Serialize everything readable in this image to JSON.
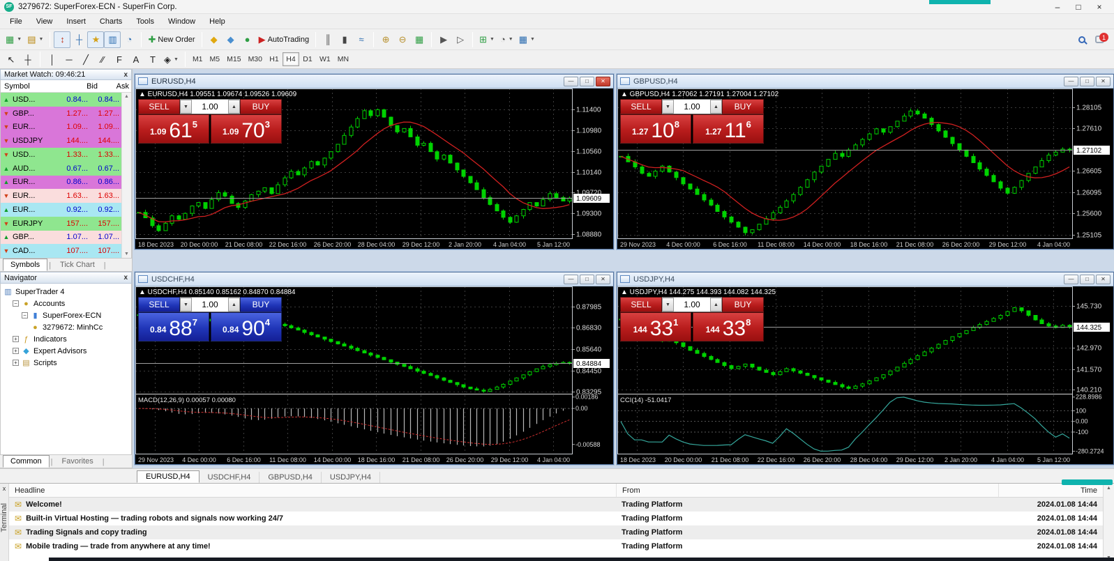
{
  "app": {
    "title": "3279672: SuperForex-ECN - SuperFin Corp.",
    "logo": "SF",
    "menus": [
      "File",
      "View",
      "Insert",
      "Charts",
      "Tools",
      "Window",
      "Help"
    ],
    "notification_count": "1"
  },
  "toolbar": {
    "standard": [
      {
        "name": "new-chart",
        "glyph": "▦",
        "color": "#2f9e44",
        "dd": true
      },
      {
        "name": "profiles",
        "glyph": "▤",
        "color": "#b8860b",
        "dd": true
      },
      {
        "name": "sep"
      },
      {
        "name": "market-watch",
        "glyph": "↕",
        "color": "#c23b22",
        "pressed": true
      },
      {
        "name": "data-window",
        "glyph": "┼",
        "color": "#2b6cb0"
      },
      {
        "name": "navigator",
        "glyph": "★",
        "color": "#d4a017",
        "pressed": true
      },
      {
        "name": "terminal",
        "glyph": "▥",
        "color": "#2b6cb0",
        "pressed": true
      },
      {
        "name": "strategy-tester",
        "glyph": "◔",
        "color": "#2b6cb0"
      },
      {
        "name": "sep"
      },
      {
        "name": "new-order",
        "glyph": "✚",
        "color": "#2f9e44",
        "label": "New Order"
      },
      {
        "name": "sep"
      },
      {
        "name": "metaeditor",
        "glyph": "◆",
        "color": "#e0a810"
      },
      {
        "name": "experts",
        "glyph": "◆",
        "color": "#4a8fd0"
      },
      {
        "name": "signals",
        "glyph": "●",
        "color": "#2f9e44"
      },
      {
        "name": "autotrading",
        "glyph": "▶",
        "color": "#cc2222",
        "label": "AutoTrading"
      },
      {
        "name": "sep"
      },
      {
        "name": "bar-chart-mode",
        "glyph": "║",
        "color": "#444444"
      },
      {
        "name": "candlestick-mode",
        "glyph": "▮",
        "color": "#444444"
      },
      {
        "name": "line-chart-mode",
        "glyph": "≈",
        "color": "#2b6cb0"
      },
      {
        "name": "sep"
      },
      {
        "name": "zoom-in",
        "glyph": "⊕",
        "color": "#b8912f"
      },
      {
        "name": "zoom-out",
        "glyph": "⊖",
        "color": "#b8912f"
      },
      {
        "name": "tile-windows",
        "glyph": "▦",
        "color": "#2f9e44"
      },
      {
        "name": "sep"
      },
      {
        "name": "auto-scroll",
        "glyph": "▶",
        "color": "#555555"
      },
      {
        "name": "chart-shift",
        "glyph": "▷",
        "color": "#555555"
      },
      {
        "name": "sep"
      },
      {
        "name": "indicators-list",
        "glyph": "⊞",
        "color": "#2f9e44",
        "dd": true
      },
      {
        "name": "periods",
        "glyph": "◔",
        "color": "#555555",
        "dd": true
      },
      {
        "name": "templates",
        "glyph": "▦",
        "color": "#2b6cb0",
        "dd": true
      }
    ],
    "drawing": [
      {
        "name": "cursor",
        "glyph": "↖",
        "color": "#222222"
      },
      {
        "name": "crosshair",
        "glyph": "┼",
        "color": "#222222"
      },
      {
        "name": "sep"
      },
      {
        "name": "vertical-line",
        "glyph": "│",
        "color": "#222222"
      },
      {
        "name": "horizontal-line",
        "glyph": "─",
        "color": "#222222"
      },
      {
        "name": "trendline",
        "glyph": "╱",
        "color": "#222222"
      },
      {
        "name": "equidistant-channel",
        "glyph": "∕∕",
        "color": "#222222"
      },
      {
        "name": "fibonacci",
        "glyph": "F",
        "color": "#222222"
      },
      {
        "name": "text",
        "glyph": "A",
        "color": "#222222"
      },
      {
        "name": "text-label",
        "glyph": "T",
        "color": "#222222"
      },
      {
        "name": "arrows-tool",
        "glyph": "◈",
        "color": "#222222",
        "dd": true
      }
    ],
    "timeframes": [
      "M1",
      "M5",
      "M15",
      "M30",
      "H1",
      "H4",
      "D1",
      "W1",
      "MN"
    ],
    "active_timeframe": "H4"
  },
  "market_watch": {
    "title": "Market Watch: 09:46:21",
    "columns": [
      "Symbol",
      "Bid",
      "Ask"
    ],
    "rows": [
      {
        "symbol": "USD...",
        "bid": "0.84...",
        "ask": "0.84...",
        "arrow": "up",
        "bg": "green",
        "txt": "blue"
      },
      {
        "symbol": "GBP...",
        "bid": "1.27...",
        "ask": "1.27...",
        "arrow": "down",
        "bg": "magenta",
        "txt": "red"
      },
      {
        "symbol": "EUR...",
        "bid": "1.09...",
        "ask": "1.09...",
        "arrow": "down",
        "bg": "magenta",
        "txt": "red"
      },
      {
        "symbol": "USDJPY",
        "bid": "144....",
        "ask": "144....",
        "arrow": "down",
        "bg": "magenta",
        "txt": "red"
      },
      {
        "symbol": "USD...",
        "bid": "1.33...",
        "ask": "1.33...",
        "arrow": "down",
        "bg": "green",
        "txt": "red"
      },
      {
        "symbol": "AUD...",
        "bid": "0.67...",
        "ask": "0.67...",
        "arrow": "up",
        "bg": "green",
        "txt": "blue"
      },
      {
        "symbol": "EUR...",
        "bid": "0.86...",
        "ask": "0.86...",
        "arrow": "up",
        "bg": "magenta",
        "txt": "blue"
      },
      {
        "symbol": "EUR...",
        "bid": "1.63...",
        "ask": "1.63...",
        "arrow": "down",
        "bg": "pink",
        "txt": "red"
      },
      {
        "symbol": "EUR...",
        "bid": "0.92...",
        "ask": "0.92...",
        "arrow": "up",
        "bg": "cyan",
        "txt": "blue"
      },
      {
        "symbol": "EURJPY",
        "bid": "157....",
        "ask": "157....",
        "arrow": "down",
        "bg": "green",
        "txt": "red"
      },
      {
        "symbol": "GBP...",
        "bid": "1.07...",
        "ask": "1.07...",
        "arrow": "up",
        "bg": "pink",
        "txt": "blue"
      },
      {
        "symbol": "CAD...",
        "bid": "107....",
        "ask": "107....",
        "arrow": "down",
        "bg": "cyan",
        "txt": "red"
      }
    ],
    "tabs": [
      "Symbols",
      "Tick Chart"
    ],
    "active_tab": "Symbols"
  },
  "navigator": {
    "title": "Navigator",
    "tree": [
      {
        "label": "SuperTrader 4",
        "icon": "platform",
        "level": 0,
        "exp": ""
      },
      {
        "label": "Accounts",
        "icon": "accounts",
        "level": 1,
        "exp": "-"
      },
      {
        "label": "SuperForex-ECN",
        "icon": "server",
        "level": 2,
        "exp": "-"
      },
      {
        "label": "3279672: MinhCc",
        "icon": "account",
        "level": 3,
        "exp": ""
      },
      {
        "label": "Indicators",
        "icon": "indicators",
        "level": 1,
        "exp": "+"
      },
      {
        "label": "Expert Advisors",
        "icon": "experts",
        "level": 1,
        "exp": "+"
      },
      {
        "label": "Scripts",
        "icon": "scripts",
        "level": 1,
        "exp": "+"
      }
    ],
    "tabs": [
      "Common",
      "Favorites"
    ],
    "active_tab": "Common"
  },
  "chart_data": [
    {
      "type": "candlestick",
      "symbol": "EURUSD,H4",
      "active": true,
      "scheme": "red",
      "ma": true,
      "info": "1.09551 1.09674 1.09526 1.09609",
      "trade": {
        "sell_label": "SELL",
        "buy_label": "BUY",
        "volume": "1.00",
        "sell_prefix": "1.09",
        "sell_big": "61",
        "sell_sup": "5",
        "buy_prefix": "1.09",
        "buy_big": "70",
        "buy_sup": "3"
      },
      "pmin": 1.0878,
      "pmax": 1.1183,
      "ticks": [
        {
          "label": "1.11400",
          "v": 1.114
        },
        {
          "label": "1.10980",
          "v": 1.1098
        },
        {
          "label": "1.10560",
          "v": 1.1056
        },
        {
          "label": "1.10140",
          "v": 1.1014
        },
        {
          "label": "1.09720",
          "v": 1.0972
        },
        {
          "label": "1.09300",
          "v": 1.093
        },
        {
          "label": "1.08880",
          "v": 1.0888
        }
      ],
      "current": {
        "label": "1.09609",
        "v": 1.09609
      },
      "dates": [
        "18 Dec 2023",
        "20 Dec 00:00",
        "21 Dec 08:00",
        "22 Dec 16:00",
        "26 Dec 20:00",
        "28 Dec 04:00",
        "29 Dec 12:00",
        "2 Jan 20:00",
        "4 Jan 04:00",
        "5 Jan 12:00"
      ],
      "closes": [
        1.0932,
        1.0921,
        1.0905,
        1.0895,
        1.091,
        1.0925,
        1.0918,
        1.093,
        1.0945,
        1.0952,
        1.094,
        1.0958,
        1.0972,
        1.0965,
        1.095,
        1.0942,
        1.0955,
        1.0968,
        1.0975,
        1.0982,
        1.097,
        1.0988,
        1.1002,
        1.1015,
        1.1008,
        1.1022,
        1.1035,
        1.1028,
        1.1042,
        1.1055,
        1.107,
        1.1088,
        1.1105,
        1.1122,
        1.1138,
        1.1128,
        1.114,
        1.1125,
        1.1108,
        1.1095,
        1.1102,
        1.1085,
        1.1068,
        1.1072,
        1.1055,
        1.104,
        1.1048,
        1.1032,
        1.1018,
        1.1005,
        1.0992,
        1.0978,
        1.0962,
        1.0948,
        1.0935,
        1.0922,
        1.0912,
        1.0925,
        1.0938,
        1.0952,
        1.0945,
        1.0958,
        1.097,
        1.0962,
        1.0955,
        1.0961
      ],
      "sub": null
    },
    {
      "type": "candlestick",
      "symbol": "GBPUSD,H4",
      "active": false,
      "scheme": "red",
      "ma": true,
      "info": "1.27062 1.27191 1.27004 1.27102",
      "trade": {
        "sell_label": "SELL",
        "buy_label": "BUY",
        "volume": "1.00",
        "sell_prefix": "1.27",
        "sell_big": "10",
        "sell_sup": "8",
        "buy_prefix": "1.27",
        "buy_big": "11",
        "buy_sup": "6"
      },
      "pmin": 1.25,
      "pmax": 1.2855,
      "ticks": [
        {
          "label": "1.28105",
          "v": 1.28105
        },
        {
          "label": "1.27610",
          "v": 1.2761
        },
        {
          "label": "1.26605",
          "v": 1.26605
        },
        {
          "label": "1.26095",
          "v": 1.26095
        },
        {
          "label": "1.25600",
          "v": 1.256
        },
        {
          "label": "1.25105",
          "v": 1.25105
        }
      ],
      "current": {
        "label": "1.27102",
        "v": 1.27102
      },
      "dates": [
        "29 Nov 2023",
        "4 Dec 00:00",
        "6 Dec 16:00",
        "11 Dec 08:00",
        "14 Dec 00:00",
        "18 Dec 16:00",
        "21 Dec 08:00",
        "26 Dec 20:00",
        "29 Dec 12:00",
        "4 Jan 04:00"
      ],
      "closes": [
        1.2695,
        1.2682,
        1.267,
        1.2655,
        1.2648,
        1.266,
        1.2672,
        1.2658,
        1.2645,
        1.263,
        1.2618,
        1.2605,
        1.2592,
        1.258,
        1.2565,
        1.2552,
        1.254,
        1.2528,
        1.2515,
        1.2522,
        1.2535,
        1.2548,
        1.2562,
        1.2575,
        1.259,
        1.2605,
        1.2622,
        1.264,
        1.2658,
        1.2672,
        1.2688,
        1.2702,
        1.2695,
        1.271,
        1.2722,
        1.2735,
        1.2748,
        1.276,
        1.2752,
        1.2765,
        1.2778,
        1.279,
        1.2802,
        1.2795,
        1.2785,
        1.277,
        1.2755,
        1.274,
        1.2725,
        1.271,
        1.2695,
        1.268,
        1.2665,
        1.265,
        1.2635,
        1.262,
        1.2608,
        1.2622,
        1.2638,
        1.2655,
        1.267,
        1.2685,
        1.2698,
        1.2705,
        1.2712,
        1.271
      ],
      "sub": null
    },
    {
      "type": "candlestick",
      "symbol": "USDCHF,H4",
      "active": false,
      "scheme": "blue",
      "ma": false,
      "info": "0.85140 0.85162 0.84870 0.84884",
      "trade": {
        "sell_label": "SELL",
        "buy_label": "BUY",
        "volume": "1.00",
        "sell_prefix": "0.84",
        "sell_big": "88",
        "sell_sup": "7",
        "buy_prefix": "0.84",
        "buy_big": "90",
        "buy_sup": "4"
      },
      "pmin": 0.8318,
      "pmax": 0.8908,
      "ticks": [
        {
          "label": "0.87985",
          "v": 0.87985
        },
        {
          "label": "0.86830",
          "v": 0.8683
        },
        {
          "label": "0.85640",
          "v": 0.8564
        },
        {
          "label": "0.84450",
          "v": 0.8445
        },
        {
          "label": "0.83295",
          "v": 0.83295
        }
      ],
      "current": {
        "label": "0.84884",
        "v": 0.84884
      },
      "dates": [
        "29 Nov 2023",
        "4 Dec 00:00",
        "6 Dec 16:00",
        "11 Dec 08:00",
        "14 Dec 00:00",
        "18 Dec 16:00",
        "21 Dec 08:00",
        "26 Dec 20:00",
        "29 Dec 12:00",
        "4 Jan 04:00"
      ],
      "closes": [
        0.8752,
        0.8745,
        0.8738,
        0.8728,
        0.8715,
        0.8705,
        0.8698,
        0.871,
        0.8722,
        0.8735,
        0.8728,
        0.8718,
        0.8705,
        0.8692,
        0.868,
        0.8668,
        0.8655,
        0.8648,
        0.8662,
        0.8675,
        0.8688,
        0.87,
        0.8692,
        0.868,
        0.8668,
        0.8655,
        0.8642,
        0.863,
        0.8618,
        0.8605,
        0.8592,
        0.858,
        0.8568,
        0.8555,
        0.8542,
        0.853,
        0.8518,
        0.8505,
        0.8492,
        0.848,
        0.8468,
        0.8455,
        0.8442,
        0.843,
        0.8418,
        0.8405,
        0.8392,
        0.838,
        0.8368,
        0.8355,
        0.8345,
        0.8338,
        0.8332,
        0.8342,
        0.8355,
        0.837,
        0.8388,
        0.8405,
        0.8422,
        0.844,
        0.8455,
        0.8468,
        0.8478,
        0.8485,
        0.849,
        0.8488
      ],
      "sub": {
        "type": "macd",
        "label": "MACD(12,26,9) 0.00057 0.00080",
        "vmax": 0.0024,
        "vmin": -0.0075,
        "pos": 0.0019,
        "neg": -0.0062,
        "lines": [
          0
        ],
        "ticks": [
          {
            "label": "0.00186",
            "v": 0.00186
          },
          {
            "label": "0.00",
            "v": 0
          },
          {
            "label": "-0.00588",
            "v": -0.00588
          }
        ]
      }
    },
    {
      "type": "candlestick",
      "symbol": "USDJPY,H4",
      "active": false,
      "scheme": "red",
      "ma": false,
      "info": "144.275 144.393 144.082 144.325",
      "trade": {
        "sell_label": "SELL",
        "buy_label": "BUY",
        "volume": "1.00",
        "sell_prefix": "144",
        "sell_big": "33",
        "sell_sup": "1",
        "buy_prefix": "144",
        "buy_big": "33",
        "buy_sup": "8"
      },
      "pmin": 139.95,
      "pmax": 147.0,
      "ticks": [
        {
          "label": "145.730",
          "v": 145.73
        },
        {
          "label": "142.970",
          "v": 142.97
        },
        {
          "label": "141.570",
          "v": 141.57
        },
        {
          "label": "140.210",
          "v": 140.21
        }
      ],
      "current": {
        "label": "144.325",
        "v": 144.325
      },
      "dates": [
        "18 Dec 2023",
        "20 Dec 00:00",
        "21 Dec 08:00",
        "22 Dec 16:00",
        "26 Dec 20:00",
        "28 Dec 04:00",
        "29 Dec 12:00",
        "2 Jan 20:00",
        "4 Jan 04:00",
        "5 Jan 12:00"
      ],
      "closes": [
        144.85,
        144.6,
        144.35,
        144.1,
        143.85,
        143.6,
        143.4,
        143.55,
        143.3,
        143.05,
        142.8,
        142.6,
        142.4,
        142.2,
        142.0,
        141.8,
        141.6,
        141.75,
        141.9,
        141.7,
        141.5,
        141.35,
        141.2,
        141.4,
        141.6,
        141.45,
        141.3,
        141.15,
        141.0,
        140.85,
        140.7,
        140.55,
        140.4,
        140.3,
        140.45,
        140.6,
        140.8,
        141.0,
        141.2,
        141.45,
        141.7,
        141.95,
        142.2,
        142.45,
        142.7,
        142.95,
        143.2,
        143.45,
        143.7,
        143.9,
        144.1,
        144.3,
        144.5,
        144.7,
        144.9,
        145.1,
        145.35,
        145.6,
        145.4,
        145.1,
        144.8,
        144.55,
        144.4,
        144.3,
        144.45,
        144.33
      ],
      "sub": {
        "type": "cci",
        "label": "CCI(14) -51.0417",
        "vmax": 260,
        "vmin": -310,
        "pos": 228,
        "neg": -280,
        "lines": [
          100,
          0,
          -100
        ],
        "ticks": [
          {
            "label": "228.8986",
            "v": 228.8986
          },
          {
            "label": "100",
            "v": 100
          },
          {
            "label": "0.00",
            "v": 0
          },
          {
            "label": "-100",
            "v": -100
          },
          {
            "label": "-280.2724",
            "v": -280.2724
          }
        ]
      }
    }
  ],
  "chart_tabs": {
    "items": [
      "EURUSD,H4",
      "USDCHF,H4",
      "GBPUSD,H4",
      "USDJPY,H4"
    ],
    "active": "EURUSD,H4"
  },
  "terminal": {
    "panel_label": "Terminal",
    "columns": [
      "Headline",
      "From",
      "Time"
    ],
    "rows": [
      {
        "headline": "Welcome!",
        "from": "Trading Platform",
        "time": "2024.01.08 14:44"
      },
      {
        "headline": "Built-in Virtual Hosting — trading robots and signals now working 24/7",
        "from": "Trading Platform",
        "time": "2024.01.08 14:44"
      },
      {
        "headline": "Trading Signals and copy trading",
        "from": "Trading Platform",
        "time": "2024.01.08 14:44"
      },
      {
        "headline": "Mobile trading — trade from anywhere at any time!",
        "from": "Trading Platform",
        "time": "2024.01.08 14:44"
      }
    ]
  }
}
